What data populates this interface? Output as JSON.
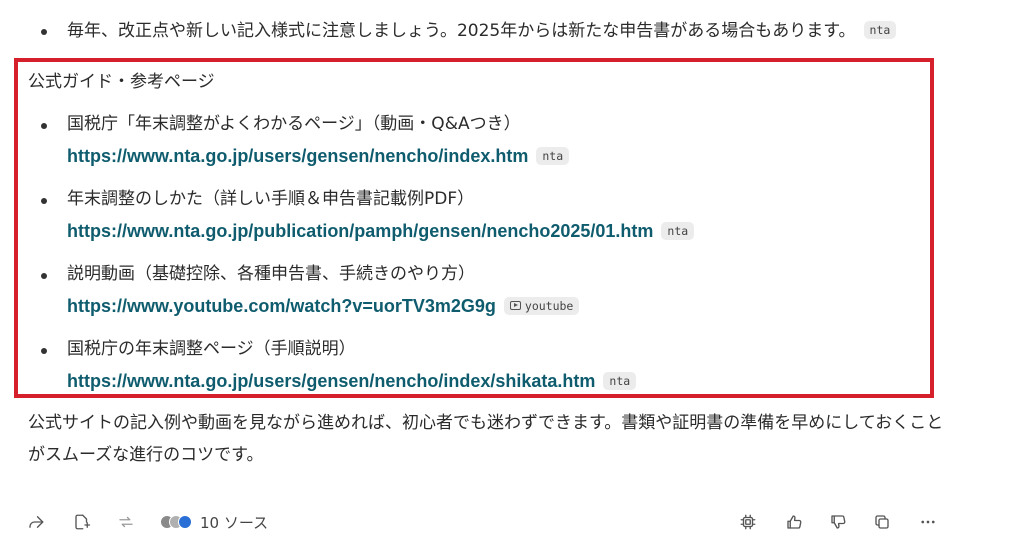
{
  "top_bullet": {
    "text": "毎年、改正点や新しい記入様式に注意しましょう。2025年からは新たな申告書がある場合もあります。",
    "badge": "nta"
  },
  "guide": {
    "title": "公式ガイド・参考ページ",
    "items": [
      {
        "label": "国税庁「年末調整がよくわかるページ」（動画・Q&Aつき）",
        "url": "https://www.nta.go.jp/users/gensen/nencho/index.htm",
        "badge": "nta"
      },
      {
        "label": "年末調整のしかた（詳しい手順＆申告書記載例PDF）",
        "url": "https://www.nta.go.jp/publication/pamph/gensen/nencho2025/01.htm",
        "badge": "nta"
      },
      {
        "label": "説明動画（基礎控除、各種申告書、手続きのやり方）",
        "url": "https://www.youtube.com/watch?v=uorTV3m2G9g",
        "badge": "youtube",
        "badge_icon": "play-icon"
      },
      {
        "label": "国税庁の年末調整ページ（手順説明）",
        "url": "https://www.nta.go.jp/users/gensen/nencho/index/shikata.htm",
        "badge": "nta"
      }
    ]
  },
  "summary": "公式サイトの記入例や動画を見ながら進めれば、初心者でも迷わずできます。書類や証明書の準備を早めにしておくことがスムーズな進行のコツです。",
  "actions": {
    "sources_label": "10 ソース",
    "icons": [
      "share-icon",
      "export-icon",
      "regenerate-icon",
      "copy-model-icon",
      "thumbs-up-icon",
      "thumbs-down-icon",
      "copy-icon",
      "more-icon"
    ]
  },
  "colors": {
    "highlight_border": "#d5202c",
    "link": "#0f5c6e",
    "badge_bg": "#ececec"
  }
}
